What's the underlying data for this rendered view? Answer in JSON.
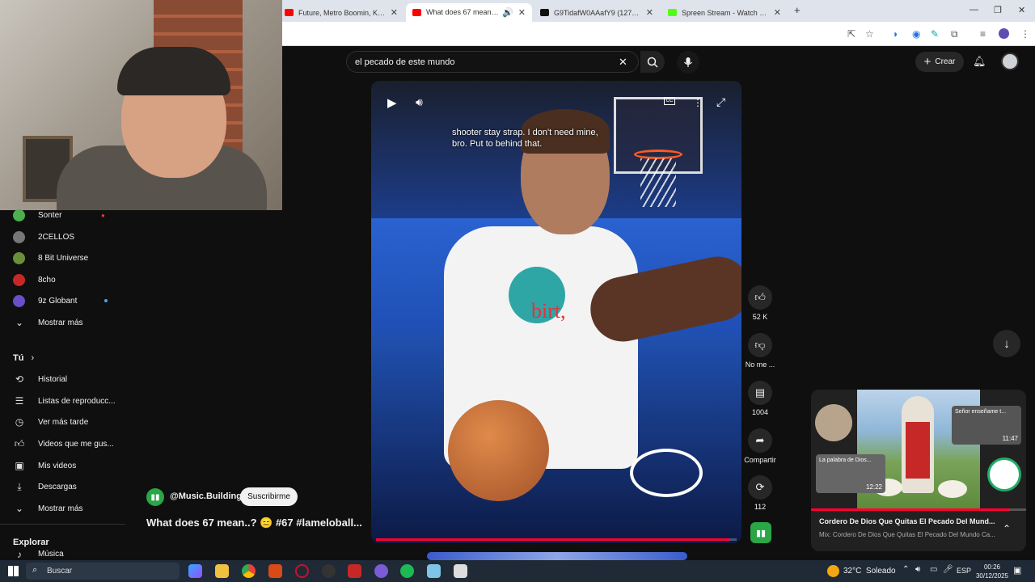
{
  "browser": {
    "tabs": [
      {
        "title": "Future, Metro Boomin, Kendrick",
        "favicon_color": "#ff0000"
      },
      {
        "title": "What does 67 mean..? 😑 #",
        "favicon_color": "#ff0000"
      },
      {
        "title": "G9TidafW0AAafY9 (1274×1265)",
        "favicon_color": "#111111"
      },
      {
        "title": "Spreen Stream - Watch Live on",
        "favicon_color": "#53fc18"
      }
    ],
    "new_tab_label": "+"
  },
  "youtube": {
    "search": {
      "value": "el pecado de este mundo",
      "placeholder": "Buscar"
    },
    "create_label": "Crear",
    "subscriptions": [
      {
        "label": "Sonter",
        "color": "#4caf50"
      },
      {
        "label": "2CELLOS",
        "color": "#777777"
      },
      {
        "label": "8 Bit Universe",
        "color": "#6a8f3a"
      },
      {
        "label": "8cho",
        "color": "#c62828"
      },
      {
        "label": "9z Globant",
        "color": "#6a4fc7"
      }
    ],
    "show_more_1": "Mostrar más",
    "you_heading": "Tú",
    "you_items": [
      {
        "label": "Historial",
        "icon": "history-icon"
      },
      {
        "label": "Listas de reproducc...",
        "icon": "playlist-icon"
      },
      {
        "label": "Ver más tarde",
        "icon": "watch-later-icon"
      },
      {
        "label": "Videos que me gus...",
        "icon": "like-icon"
      },
      {
        "label": "Mis videos",
        "icon": "my-videos-icon"
      },
      {
        "label": "Descargas",
        "icon": "download-icon"
      }
    ],
    "show_more_2": "Mostrar más",
    "explore_heading": "Explorar",
    "explore_first": "Música"
  },
  "short": {
    "caption": "shooter stay strap. I don't need mine, bro. Put to behind that.",
    "burned_text": "birt,",
    "channel": "@Music.Building",
    "subscribe_label": "Suscribirme",
    "title": "What does 67 mean..? 😑 #67 #lameloball...",
    "likes": "52 K",
    "dislike_label": "No me ...",
    "comments": "1004",
    "share_label": "Compartir",
    "remix_count": "112",
    "progress_fraction": 0.98
  },
  "miniplayer": {
    "title": "Cordero De Dios Que Quitas El Pecado Del Mund...",
    "subtitle": "Mix: Cordero De Dios Que Quitas El Pecado Del Mundo Ca...",
    "thumb1_title": "Señor enseñame t...",
    "thumb1_duration": "11:47",
    "thumb2_title": "La palabra de Dios...",
    "thumb2_duration": "12:22",
    "progress_fraction": 0.92
  },
  "taskbar": {
    "search_placeholder": "Buscar",
    "weather": "32°C  Soleado",
    "lang": "ESP",
    "time": "00:26",
    "date": "30/12/2025"
  }
}
